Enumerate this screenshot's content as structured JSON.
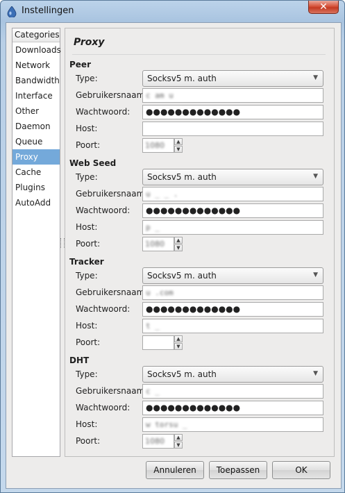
{
  "window": {
    "title": "Instellingen",
    "close_glyph": "✕",
    "icon": "deluge-drop-icon"
  },
  "categories": {
    "header": "Categories",
    "items": [
      "Downloads",
      "Network",
      "Bandwidth",
      "Interface",
      "Other",
      "Daemon",
      "Queue",
      "Proxy",
      "Cache",
      "Plugins",
      "AutoAdd"
    ],
    "selected": "Proxy"
  },
  "page": {
    "title": "Proxy"
  },
  "labels": {
    "type": "Type:",
    "username": "Gebruikersnaam:",
    "password": "Wachtwoord:",
    "host": "Host:",
    "port": "Poort:"
  },
  "sections": [
    {
      "title": "Peer",
      "type": "Socksv5 m. auth",
      "username": "c           am      u",
      "password": "●●●●●●●●●●●●●",
      "host": "                  ",
      "port": "1080"
    },
    {
      "title": "Web Seed",
      "type": "Socksv5 m. auth",
      "username": "u       _   _  .",
      "password": "●●●●●●●●●●●●●",
      "host": "p          _",
      "port": "1080"
    },
    {
      "title": "Tracker",
      "type": "Socksv5 m. auth",
      "username": "u        .com",
      "password": "●●●●●●●●●●●●●",
      "host": "      t      _",
      "port": ""
    },
    {
      "title": "DHT",
      "type": "Socksv5 m. auth",
      "username": "c   _",
      "password": "●●●●●●●●●●●●●",
      "host": "   w   torsu     _",
      "port": "1080"
    }
  ],
  "buttons": {
    "cancel": "Annuleren",
    "apply": "Toepassen",
    "ok": "OK"
  },
  "colors": {
    "selection": "#74a9da",
    "close": "#c43a22"
  }
}
